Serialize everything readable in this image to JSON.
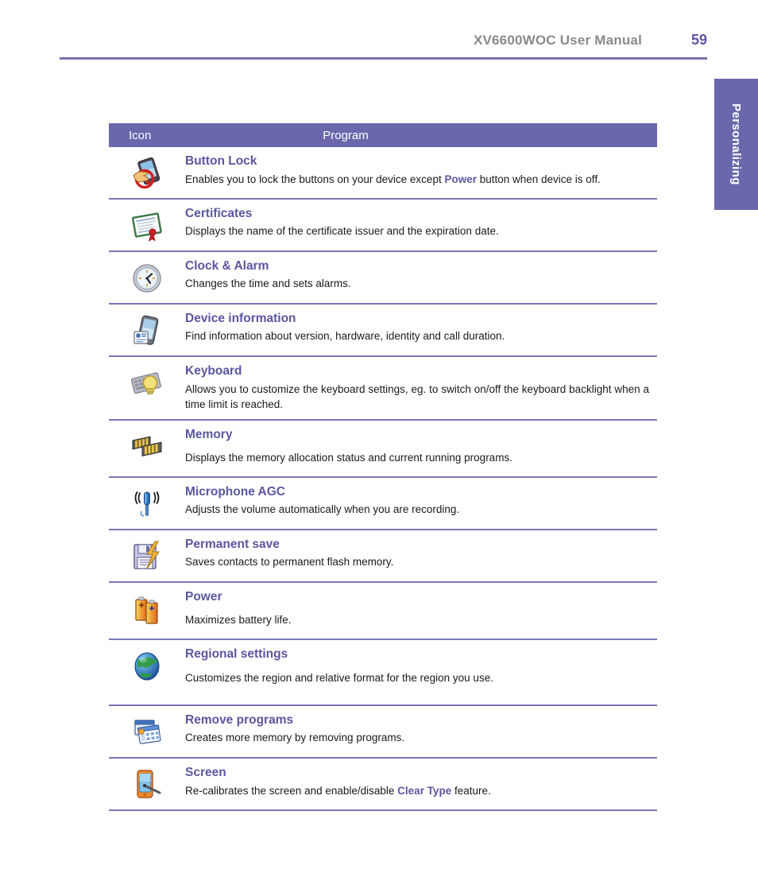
{
  "header": {
    "title": "XV6600WOC User Manual",
    "page_number": "59"
  },
  "side_tab": {
    "label": "Personalizing"
  },
  "table": {
    "columns": {
      "icon": "Icon",
      "program": "Program"
    },
    "rows": [
      {
        "icon_name": "button-lock-icon",
        "name": "Button Lock",
        "desc_pre": "Enables you to lock the buttons on your device except ",
        "desc_hl": "Power",
        "desc_post": " button when device is off."
      },
      {
        "icon_name": "certificates-icon",
        "name": "Certificates",
        "desc_pre": "Displays the name of the certificate issuer and the expiration date.",
        "desc_hl": "",
        "desc_post": ""
      },
      {
        "icon_name": "clock-alarm-icon",
        "name": "Clock & Alarm",
        "desc_pre": "Changes the time and sets alarms.",
        "desc_hl": "",
        "desc_post": ""
      },
      {
        "icon_name": "device-information-icon",
        "name": "Device information",
        "desc_pre": "Find information about version, hardware, identity and call duration.",
        "desc_hl": "",
        "desc_post": ""
      },
      {
        "icon_name": "keyboard-icon",
        "name": "Keyboard",
        "desc_pre": "Allows you to customize the keyboard settings, eg. to switch on/off the keyboard backlight when a time limit is reached.",
        "desc_hl": "",
        "desc_post": ""
      },
      {
        "icon_name": "memory-icon",
        "name": "Memory",
        "desc_pre": "Displays the memory allocation status and current running programs.",
        "desc_hl": "",
        "desc_post": ""
      },
      {
        "icon_name": "microphone-agc-icon",
        "name": "Microphone AGC",
        "desc_pre": "Adjusts the volume automatically when you are recording.",
        "desc_hl": "",
        "desc_post": ""
      },
      {
        "icon_name": "permanent-save-icon",
        "name": "Permanent save",
        "desc_pre": "Saves contacts to permanent flash memory.",
        "desc_hl": "",
        "desc_post": ""
      },
      {
        "icon_name": "power-icon",
        "name": "Power",
        "desc_pre": "Maximizes battery life.",
        "desc_hl": "",
        "desc_post": ""
      },
      {
        "icon_name": "regional-settings-icon",
        "name": "Regional settings",
        "desc_pre": "Customizes the region and relative format for the region you use.",
        "desc_hl": "",
        "desc_post": ""
      },
      {
        "icon_name": "remove-programs-icon",
        "name": "Remove programs",
        "desc_pre": "Creates more memory by removing programs.",
        "desc_hl": "",
        "desc_post": ""
      },
      {
        "icon_name": "screen-icon",
        "name": "Screen",
        "desc_pre": "Re-calibrates the screen and enable/disable ",
        "desc_hl": "Clear Type",
        "desc_post": " feature."
      }
    ]
  },
  "colors": {
    "accent_purple": "#6b67ad",
    "heading_purple": "#5b56a0",
    "header_gray": "#8a8a8a",
    "rule_purple": "#7a76b5"
  }
}
